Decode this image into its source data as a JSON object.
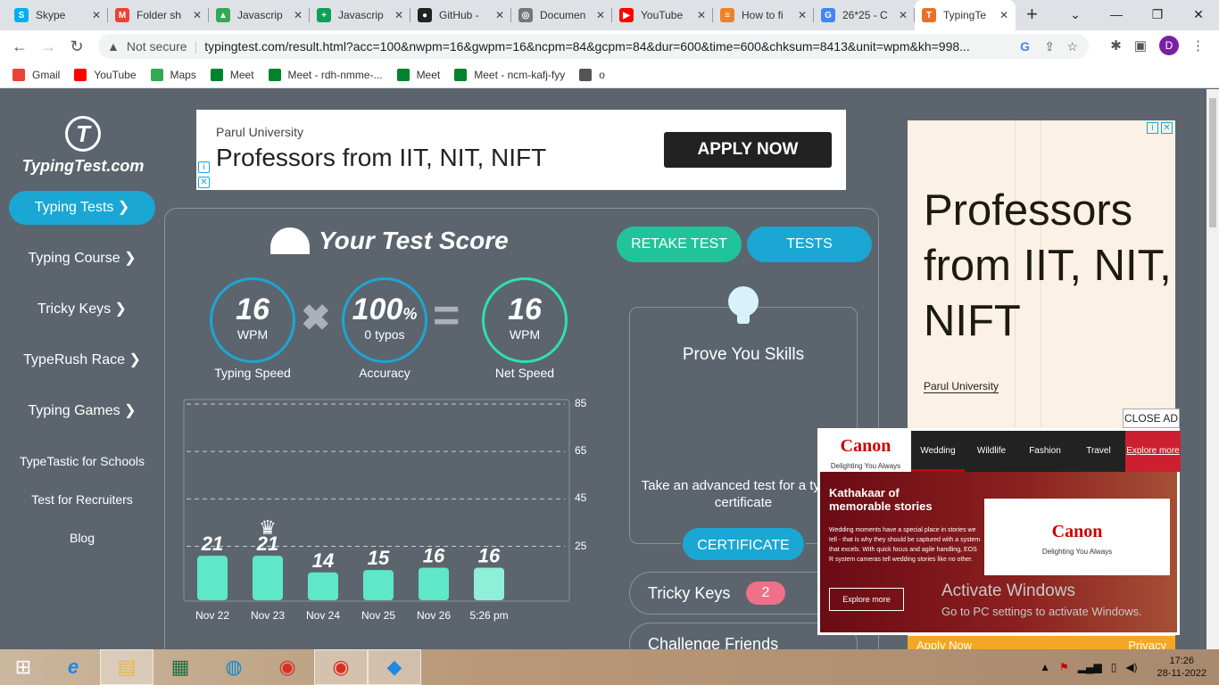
{
  "tabs": [
    {
      "label": "Skype",
      "icon": "skype-icon",
      "color": "#00aff0",
      "glyph": "S"
    },
    {
      "label": "Folder sh",
      "icon": "gmail-icon",
      "color": "#ea4335",
      "glyph": "M"
    },
    {
      "label": "Javascrip",
      "icon": "drive-icon",
      "color": "#34a853",
      "glyph": "▲"
    },
    {
      "label": "Javascrip",
      "icon": "sheets-icon",
      "color": "#0f9d58",
      "glyph": "+"
    },
    {
      "label": "GitHub -",
      "icon": "github-icon",
      "color": "#222222",
      "glyph": "●"
    },
    {
      "label": "Documen",
      "icon": "globe-icon",
      "color": "#777777",
      "glyph": "◎"
    },
    {
      "label": "YouTube",
      "icon": "youtube-icon",
      "color": "#ff0000",
      "glyph": "▶"
    },
    {
      "label": "How to fi",
      "icon": "stackoverflow-icon",
      "color": "#f48024",
      "glyph": "≡"
    },
    {
      "label": "26*25 - C",
      "icon": "google-icon",
      "color": "#4285f4",
      "glyph": "G"
    },
    {
      "label": "TypingTe",
      "icon": "typingtest-icon",
      "color": "#e8702a",
      "glyph": "T"
    }
  ],
  "window": {
    "minimize": "—",
    "restore": "❐",
    "close": "✕",
    "newtab": "+",
    "dropdown": "⌄"
  },
  "address": {
    "not_secure": "Not secure",
    "url": "typingtest.com/result.html?acc=100&nwpm=16&gwpm=16&ncpm=84&gcpm=84&dur=600&time=600&chksum=8413&unit=wpm&kh=998...",
    "avatar": "D"
  },
  "bookmarks": [
    {
      "label": "Gmail",
      "color": "#ea4335"
    },
    {
      "label": "YouTube",
      "color": "#ff0000"
    },
    {
      "label": "Maps",
      "color": "#34a853"
    },
    {
      "label": "Meet",
      "color": "#00832d"
    },
    {
      "label": "Meet - rdh-nmme-...",
      "color": "#00832d"
    },
    {
      "label": "Meet",
      "color": "#00832d"
    },
    {
      "label": "Meet - ncm-kafj-fyy",
      "color": "#00832d"
    },
    {
      "label": "o",
      "color": "#555555"
    }
  ],
  "sidebar": {
    "logo_text": "TypingTest.com",
    "logo_glyph": "T",
    "items": [
      {
        "label": "Typing Tests ❯",
        "active": true
      },
      {
        "label": "Typing Course ❯"
      },
      {
        "label": "Tricky Keys ❯"
      },
      {
        "label": "TypeRush Race ❯"
      },
      {
        "label": "Typing Games ❯"
      }
    ],
    "links": [
      "TypeTastic for Schools",
      "Test for Recruiters",
      "Blog"
    ]
  },
  "top_ad": {
    "org": "Parul University",
    "headline": "Professors from IIT, NIT, NIFT",
    "button": "APPLY NOW",
    "info": "i",
    "close": "✕"
  },
  "score": {
    "title": "Your Test Score",
    "retake": "RETAKE TEST",
    "tests": "TESTS",
    "speed": {
      "value": "16",
      "unit": "WPM",
      "label": "Typing Speed"
    },
    "accuracy": {
      "value": "100",
      "pct": "%",
      "unit": "0 typos",
      "label": "Accuracy"
    },
    "net": {
      "value": "16",
      "unit": "WPM",
      "label": "Net Speed"
    },
    "times": "✖",
    "equals": "="
  },
  "chart_data": {
    "type": "bar",
    "categories": [
      "Nov 22",
      "Nov 23",
      "Nov 24",
      "Nov 25",
      "Nov 26",
      "5:26 pm"
    ],
    "values": [
      21,
      21,
      14,
      15,
      16,
      16
    ],
    "yticks": [
      25,
      45,
      65,
      85
    ],
    "ylim": [
      0,
      85
    ],
    "best_marker": "♛",
    "color": "#5ee8c7"
  },
  "prove": {
    "title": "Prove You Skills",
    "desc": "Take an advanced test for a typing certificate",
    "button": "CERTIFICATE"
  },
  "tricky": {
    "label": "Tricky Keys",
    "count": "2"
  },
  "challenge": {
    "label": "Challenge Friends"
  },
  "side_ad": {
    "headline": "Professors from IIT, NIT, NIFT",
    "org": "Parul University",
    "footer": "Apply Now",
    "privacy": "Privacy",
    "info": "i",
    "close": "✕"
  },
  "canon_ad": {
    "close_label": "CLOSE AD",
    "brand": "Canon",
    "tagline": "Delighting You Always",
    "nav": [
      "Wedding",
      "Wildlife",
      "Fashion",
      "Travel",
      "Explore more"
    ],
    "headline": "Kathakaar of memorable stories",
    "text": "Wedding moments have a special place in stories we tell - that is why they should be captured with a system that excels. With quick focus and agile handling, EOS R system cameras tell wedding stories like no other.",
    "button": "Explore more"
  },
  "activation": {
    "title": "Activate Windows",
    "subtitle": "Go to PC settings to activate Windows."
  },
  "taskbar": {
    "time": "17:26",
    "date": "28-11-2022"
  }
}
